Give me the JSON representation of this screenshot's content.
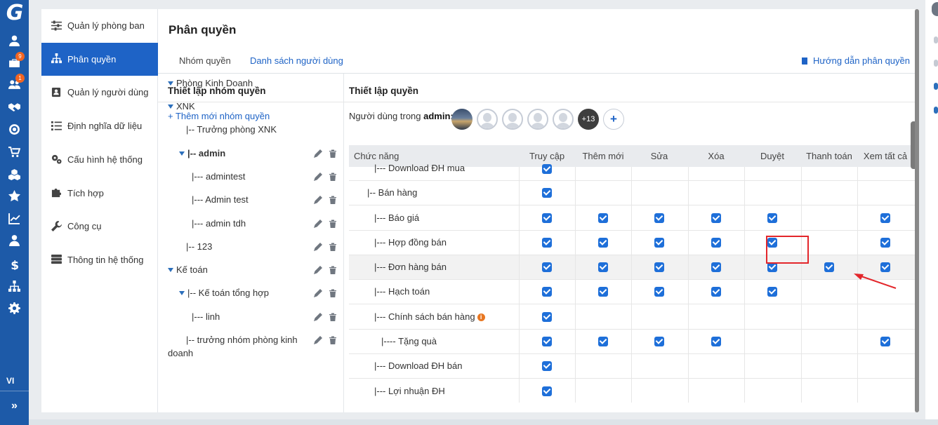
{
  "rail": {
    "logo": "G",
    "icons": [
      {
        "name": "user-icon"
      },
      {
        "name": "briefcase-icon",
        "badge": "9"
      },
      {
        "name": "users-icon",
        "badge": "1"
      },
      {
        "name": "handshake-icon"
      },
      {
        "name": "target-icon"
      },
      {
        "name": "cart-icon"
      },
      {
        "name": "cubes-icon"
      },
      {
        "name": "star-icon"
      },
      {
        "name": "chart-line-icon"
      },
      {
        "name": "user-tie-icon"
      },
      {
        "name": "dollar-icon"
      },
      {
        "name": "sitemap-icon"
      },
      {
        "name": "gear-icon"
      }
    ],
    "language": "VI",
    "collapse": "»"
  },
  "menu": {
    "items": [
      {
        "label": "Quản lý phòng ban",
        "icon": "sliders-icon",
        "active": false
      },
      {
        "label": "Phân quyền",
        "icon": "sitemap-icon",
        "active": true
      },
      {
        "label": "Quản lý người dùng",
        "icon": "id-card-icon",
        "active": false
      },
      {
        "label": "Định nghĩa dữ liệu",
        "icon": "list-icon",
        "active": false
      },
      {
        "label": "Cấu hình hệ thống",
        "icon": "cogs-icon",
        "active": false
      },
      {
        "label": "Tích hợp",
        "icon": "puzzle-icon",
        "active": false
      },
      {
        "label": "Công cụ",
        "icon": "wrench-icon",
        "active": false
      },
      {
        "label": "Thông tin hệ thống",
        "icon": "server-icon",
        "active": false
      }
    ]
  },
  "page": {
    "title": "Phân quyền",
    "tabs": [
      "Nhóm quyền",
      "Danh sách người dùng"
    ],
    "guide_link": "Hướng dẫn phân quyền"
  },
  "groups": {
    "title": "Thiết lập nhóm quyền",
    "add_label": "+ Thêm mới nhóm quyền",
    "nodes": [
      {
        "label": "Phòng Kinh Doanh",
        "caret": true,
        "actions": false,
        "bold": false
      },
      {
        "label": "XNK",
        "caret": true,
        "actions": false,
        "bold": false
      },
      {
        "label": "|-- Trưởng phòng XNK",
        "caret": false,
        "actions": false,
        "bold": false
      },
      {
        "label": "|-- admin",
        "caret": true,
        "actions": true,
        "bold": true
      },
      {
        "label": "|--- admintest",
        "caret": false,
        "actions": true,
        "bold": false
      },
      {
        "label": "|--- Admin test",
        "caret": false,
        "actions": true,
        "bold": false
      },
      {
        "label": "|--- admin tdh",
        "caret": false,
        "actions": true,
        "bold": false
      },
      {
        "label": "|-- 123",
        "caret": false,
        "actions": true,
        "bold": false
      },
      {
        "label": "Kế toán",
        "caret": true,
        "actions": true,
        "bold": false
      },
      {
        "label": "|-- Kế toán tổng hợp",
        "caret": true,
        "actions": true,
        "bold": false
      },
      {
        "label": "|--- linh",
        "caret": false,
        "actions": true,
        "bold": false
      },
      {
        "label": "|-- trưởng nhóm phòng kinh",
        "caret": false,
        "actions": true,
        "bold": false
      },
      {
        "label": "doanh",
        "caret": false,
        "actions": false,
        "bold": false
      }
    ]
  },
  "permissions": {
    "title": "Thiết lập quyền",
    "users_prefix": "Người dùng trong",
    "users_group": "admin:",
    "more_users": "+13",
    "add_user": "+",
    "columns": [
      "Chức năng",
      "Truy cập",
      "Thêm mới",
      "Sửa",
      "Xóa",
      "Duyệt",
      "Thanh toán",
      "Xem tất cả"
    ],
    "rows": [
      {
        "name": "|--- Download ĐH mua",
        "checks": [
          true,
          false,
          false,
          false,
          false,
          false
        ],
        "info": false,
        "highlight": false
      },
      {
        "name": "|-- Bán hàng",
        "checks": [
          true,
          false,
          false,
          false,
          false,
          false
        ],
        "info": false,
        "highlight": false
      },
      {
        "name": "|--- Báo giá",
        "checks": [
          true,
          true,
          true,
          true,
          true,
          false,
          true
        ],
        "info": false,
        "highlight": false
      },
      {
        "name": "|--- Hợp đồng bán",
        "checks": [
          true,
          true,
          true,
          true,
          true,
          false,
          true
        ],
        "info": false,
        "highlight": false
      },
      {
        "name": "|--- Đơn hàng bán",
        "checks": [
          true,
          true,
          true,
          true,
          true,
          true,
          true
        ],
        "info": false,
        "highlight": true
      },
      {
        "name": "|--- Hạch toán",
        "checks": [
          true,
          true,
          true,
          true,
          true,
          false,
          false
        ],
        "info": false,
        "highlight": false
      },
      {
        "name": "|--- Chính sách bán hàng",
        "checks": [
          true,
          false,
          false,
          false,
          false,
          false,
          false
        ],
        "info": true,
        "highlight": false
      },
      {
        "name": "|---- Tặng quà",
        "checks": [
          true,
          true,
          true,
          true,
          false,
          false,
          true
        ],
        "info": false,
        "highlight": false
      },
      {
        "name": "|--- Download ĐH bán",
        "checks": [
          true,
          false,
          false,
          false,
          false,
          false,
          false
        ],
        "info": false,
        "highlight": false
      },
      {
        "name": "|--- Lợi nhuận ĐH",
        "checks": [
          true,
          false,
          false,
          false,
          false,
          false,
          false
        ],
        "info": false,
        "highlight": false
      }
    ]
  },
  "colors": {
    "rail": "#1d5aa8",
    "accent": "#1e63c6",
    "checkbox": "#1e6fd9",
    "annotation": "#e3262b",
    "badge": "#f26522"
  }
}
